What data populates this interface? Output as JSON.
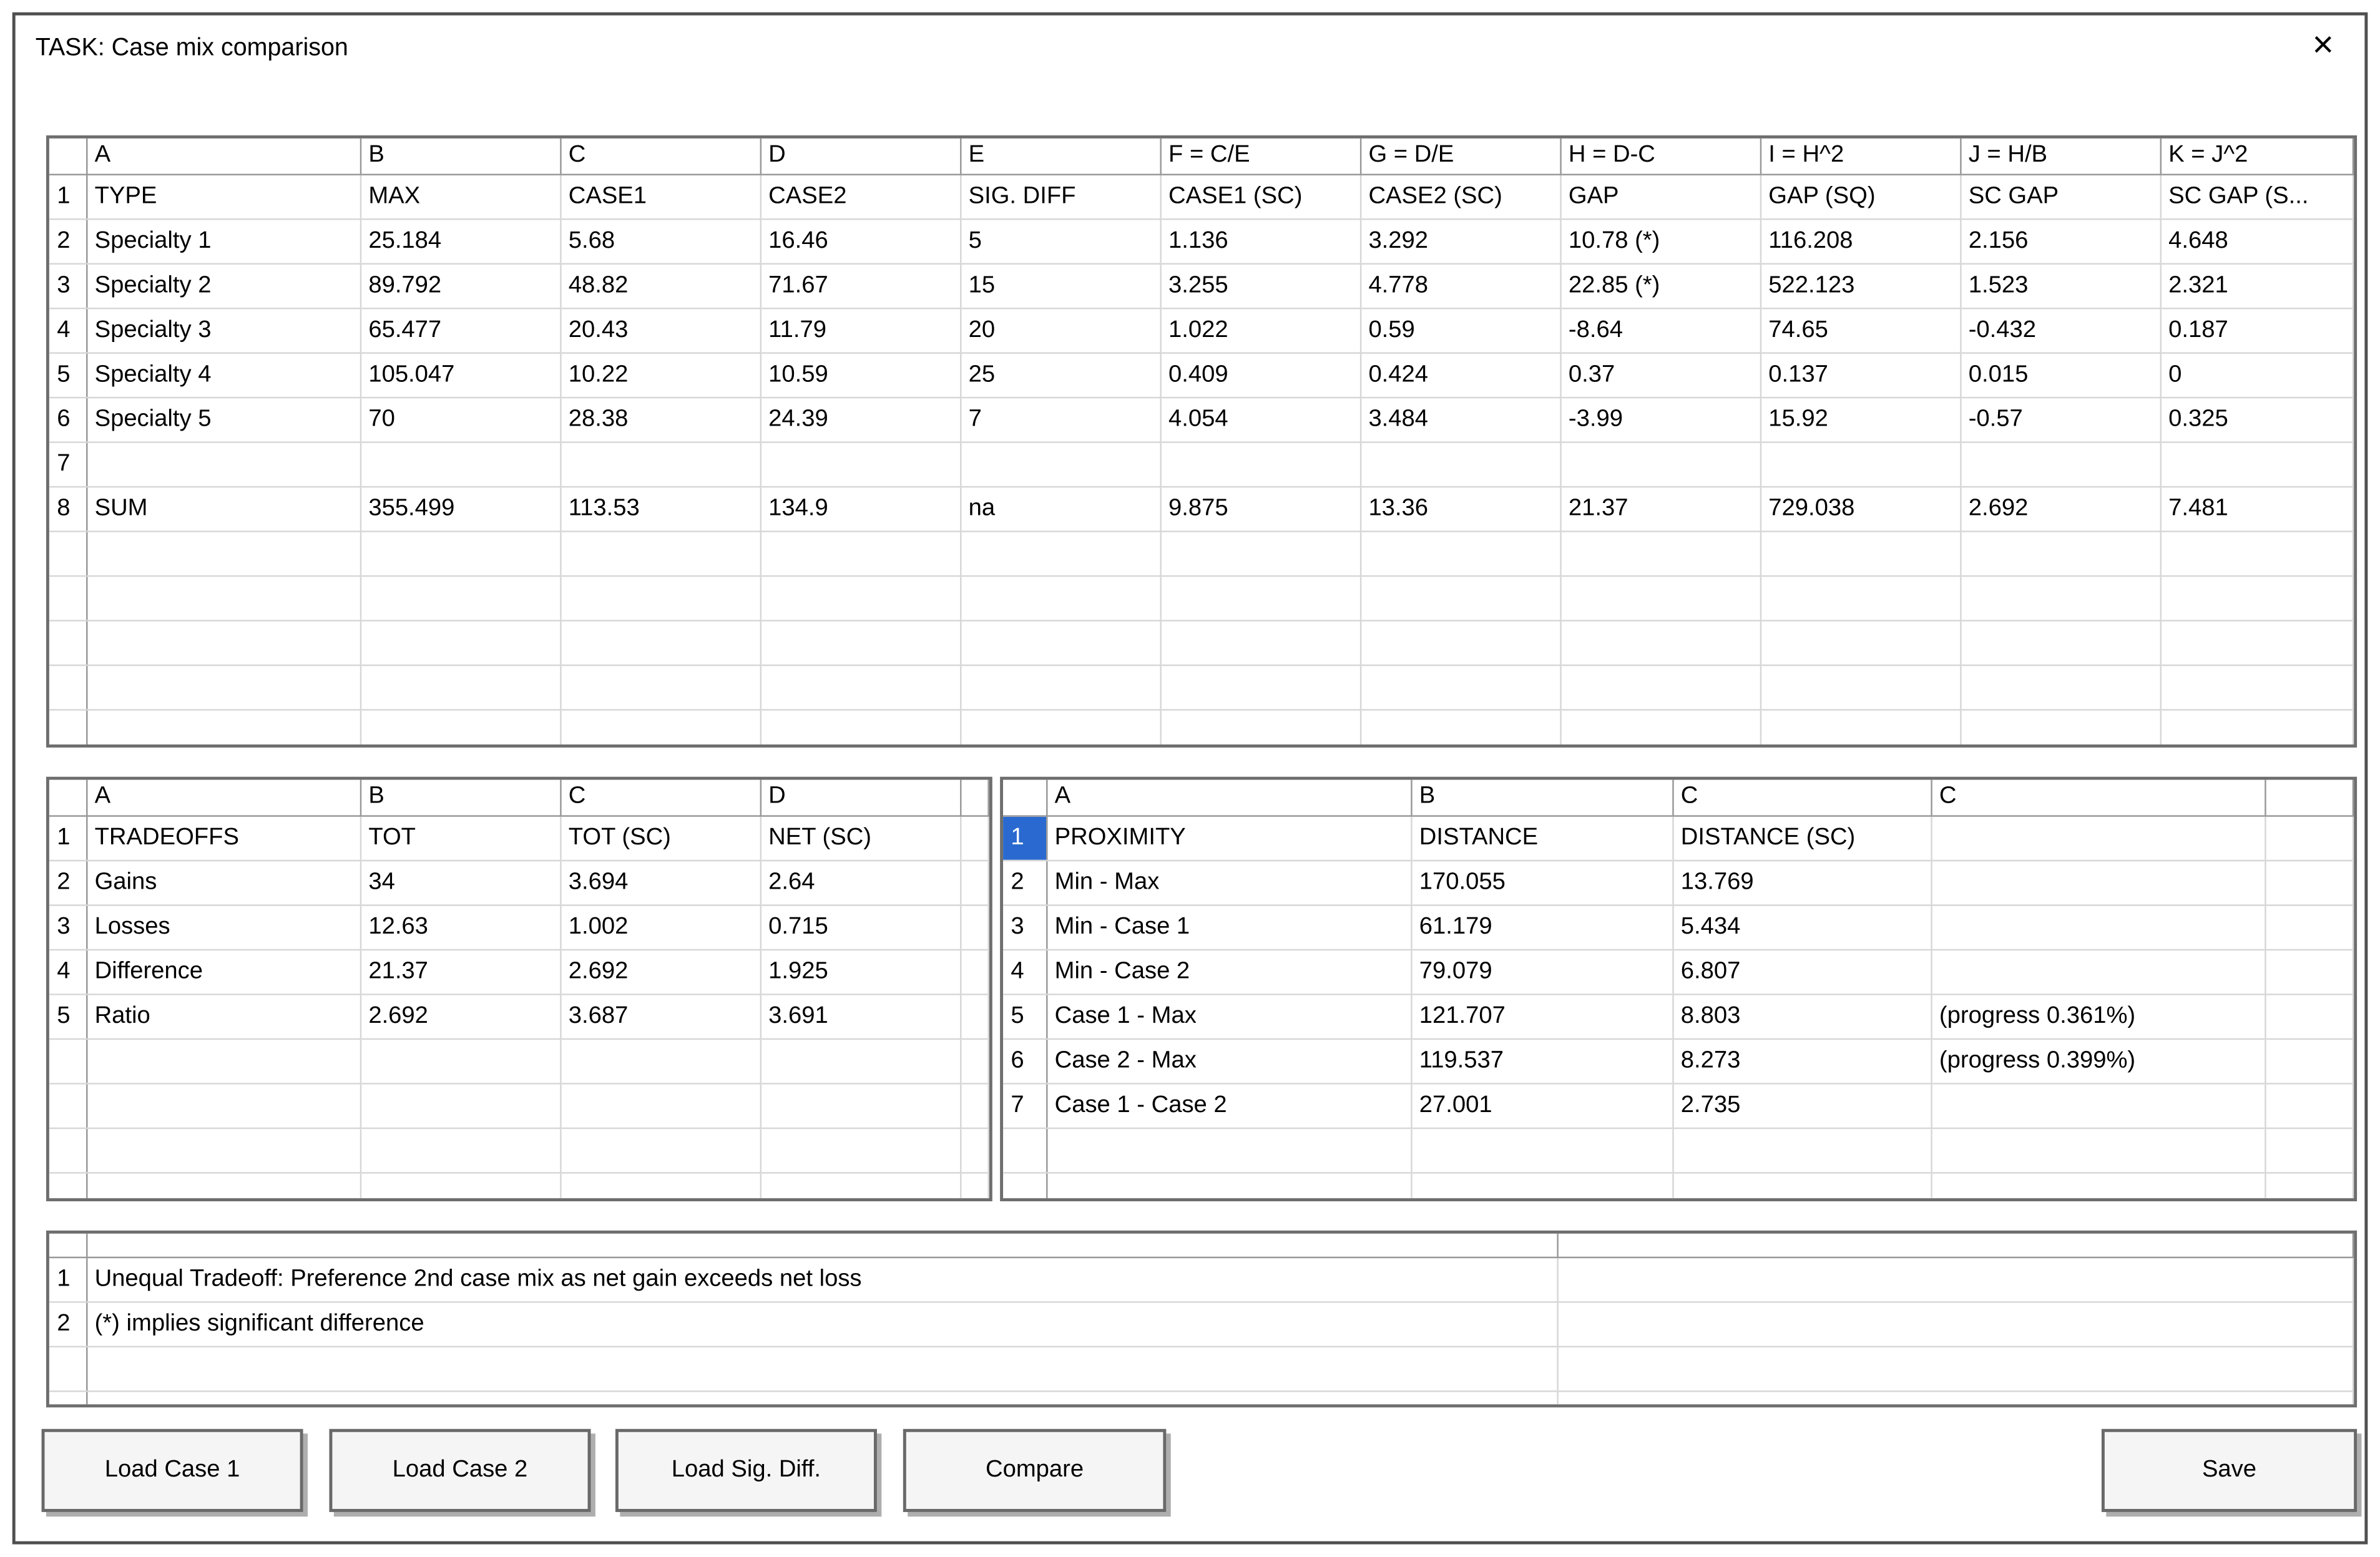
{
  "window": {
    "title": "TASK: Case mix comparison",
    "close": "×"
  },
  "main_grid": {
    "col_headers": [
      "A",
      "B",
      "C",
      "D",
      "E",
      "F = C/E",
      "G = D/E",
      "H = D-C",
      "I = H^2",
      "J = H/B",
      "K = J^2"
    ],
    "rows": [
      {
        "num": "1",
        "cells": [
          "TYPE",
          "MAX",
          "CASE1",
          "CASE2",
          "SIG. DIFF",
          "CASE1 (SC)",
          "CASE2 (SC)",
          "GAP",
          "GAP (SQ)",
          "SC GAP",
          "SC GAP (S..."
        ]
      },
      {
        "num": "2",
        "cells": [
          "Specialty 1",
          "25.184",
          "5.68",
          "16.46",
          "5",
          "1.136",
          "3.292",
          "10.78 (*)",
          "116.208",
          "2.156",
          "4.648"
        ]
      },
      {
        "num": "3",
        "cells": [
          "Specialty 2",
          "89.792",
          "48.82",
          "71.67",
          "15",
          "3.255",
          "4.778",
          "22.85 (*)",
          "522.123",
          "1.523",
          "2.321"
        ]
      },
      {
        "num": "4",
        "cells": [
          "Specialty 3",
          "65.477",
          "20.43",
          "11.79",
          "20",
          "1.022",
          "0.59",
          "-8.64",
          "74.65",
          "-0.432",
          "0.187"
        ]
      },
      {
        "num": "5",
        "cells": [
          "Specialty 4",
          "105.047",
          "10.22",
          "10.59",
          "25",
          "0.409",
          "0.424",
          "0.37",
          "0.137",
          "0.015",
          "0"
        ]
      },
      {
        "num": "6",
        "cells": [
          "Specialty 5",
          "70",
          "28.38",
          "24.39",
          "7",
          "4.054",
          "3.484",
          "-3.99",
          "15.92",
          "-0.57",
          "0.325"
        ]
      },
      {
        "num": "7",
        "cells": [
          "",
          "",
          "",
          "",
          "",
          "",
          "",
          "",
          "",
          "",
          ""
        ]
      },
      {
        "num": "8",
        "cells": [
          "SUM",
          "355.499",
          "113.53",
          "134.9",
          "na",
          "9.875",
          "13.36",
          "21.37",
          "729.038",
          "2.692",
          "7.481"
        ]
      }
    ]
  },
  "tradeoffs_grid": {
    "col_headers": [
      "A",
      "B",
      "C",
      "D"
    ],
    "rows": [
      {
        "num": "1",
        "cells": [
          "TRADEOFFS",
          "TOT",
          "TOT (SC)",
          "NET (SC)"
        ]
      },
      {
        "num": "2",
        "cells": [
          "Gains",
          "34",
          "3.694",
          "2.64"
        ]
      },
      {
        "num": "3",
        "cells": [
          "Losses",
          "12.63",
          "1.002",
          "0.715"
        ]
      },
      {
        "num": "4",
        "cells": [
          "Difference",
          "21.37",
          "2.692",
          "1.925"
        ]
      },
      {
        "num": "5",
        "cells": [
          "Ratio",
          "2.692",
          "3.687",
          "3.691"
        ]
      }
    ]
  },
  "proximity_grid": {
    "col_headers": [
      "A",
      "B",
      "C",
      "C"
    ],
    "selected_row_number": "1",
    "rows": [
      {
        "num": "1",
        "cells": [
          "PROXIMITY",
          "DISTANCE",
          "DISTANCE (SC)",
          ""
        ]
      },
      {
        "num": "2",
        "cells": [
          "Min - Max",
          "170.055",
          "13.769",
          ""
        ]
      },
      {
        "num": "3",
        "cells": [
          "Min - Case 1",
          "61.179",
          "5.434",
          ""
        ]
      },
      {
        "num": "4",
        "cells": [
          "Min - Case 2",
          "79.079",
          "6.807",
          ""
        ]
      },
      {
        "num": "5",
        "cells": [
          "Case 1 - Max",
          "121.707",
          "8.803",
          "(progress 0.361%)"
        ]
      },
      {
        "num": "6",
        "cells": [
          "Case 2 - Max",
          "119.537",
          "8.273",
          "(progress 0.399%)"
        ]
      },
      {
        "num": "7",
        "cells": [
          "Case 1 - Case 2",
          "27.001",
          "2.735",
          ""
        ]
      }
    ]
  },
  "notes_grid": {
    "rows": [
      {
        "num": "1",
        "text": "Unequal Tradeoff: Preference 2nd case mix as net gain exceeds net loss"
      },
      {
        "num": "2",
        "text": "(*) implies significant difference"
      }
    ]
  },
  "buttons": {
    "load_case_1": "Load Case 1",
    "load_case_2": "Load Case 2",
    "load_sig_diff": "Load Sig. Diff.",
    "compare": "Compare",
    "save": "Save"
  },
  "colors": {
    "selection_blue": "#2a6ad0",
    "grid_border": "#6e6e6e",
    "gridline": "#d7d7d7"
  }
}
